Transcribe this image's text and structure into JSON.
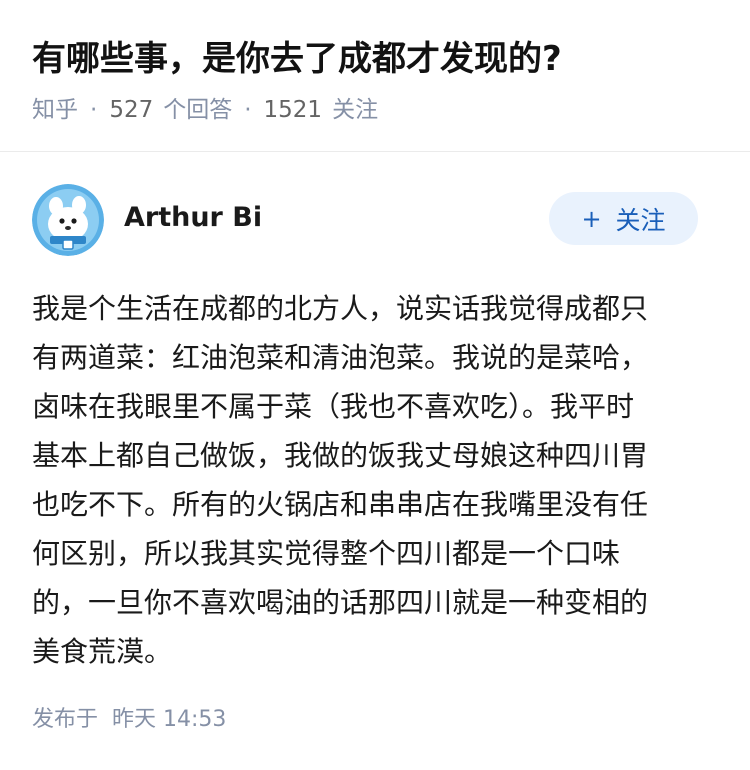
{
  "question": {
    "title": "有哪些事，是你去了成都才发现的?",
    "source": "知乎",
    "answer_count": "527",
    "answer_label": "个回答",
    "follow_count": "1521",
    "follow_label": "关注"
  },
  "author": {
    "name": "Arthur Bi",
    "follow_button": {
      "plus": "+",
      "label": "关注"
    }
  },
  "answer": {
    "lines": [
      "我是个生活在成都的北方人，说实话我觉得成都只",
      "有两道菜：红油泡菜和清油泡菜。我说的是菜哈，",
      "卤味在我眼里不属于菜（我也不喜欢吃）。我平时",
      "基本上都自己做饭，我做的饭我丈母娘这种四川胃",
      "也吃不下。所有的火锅店和串串店在我嘴里没有任",
      "何区别，所以我其实觉得整个四川都是一个口味",
      "的，一旦你不喜欢喝油的话那四川就是一种变相的",
      "美食荒漠。"
    ]
  },
  "footer": {
    "published_label": "发布于",
    "published_time": "昨天 14:53"
  },
  "colors": {
    "accent": "#1a5fb9",
    "follow_button_bg": "#e9f2fd",
    "meta_gray": "#8590a6"
  }
}
